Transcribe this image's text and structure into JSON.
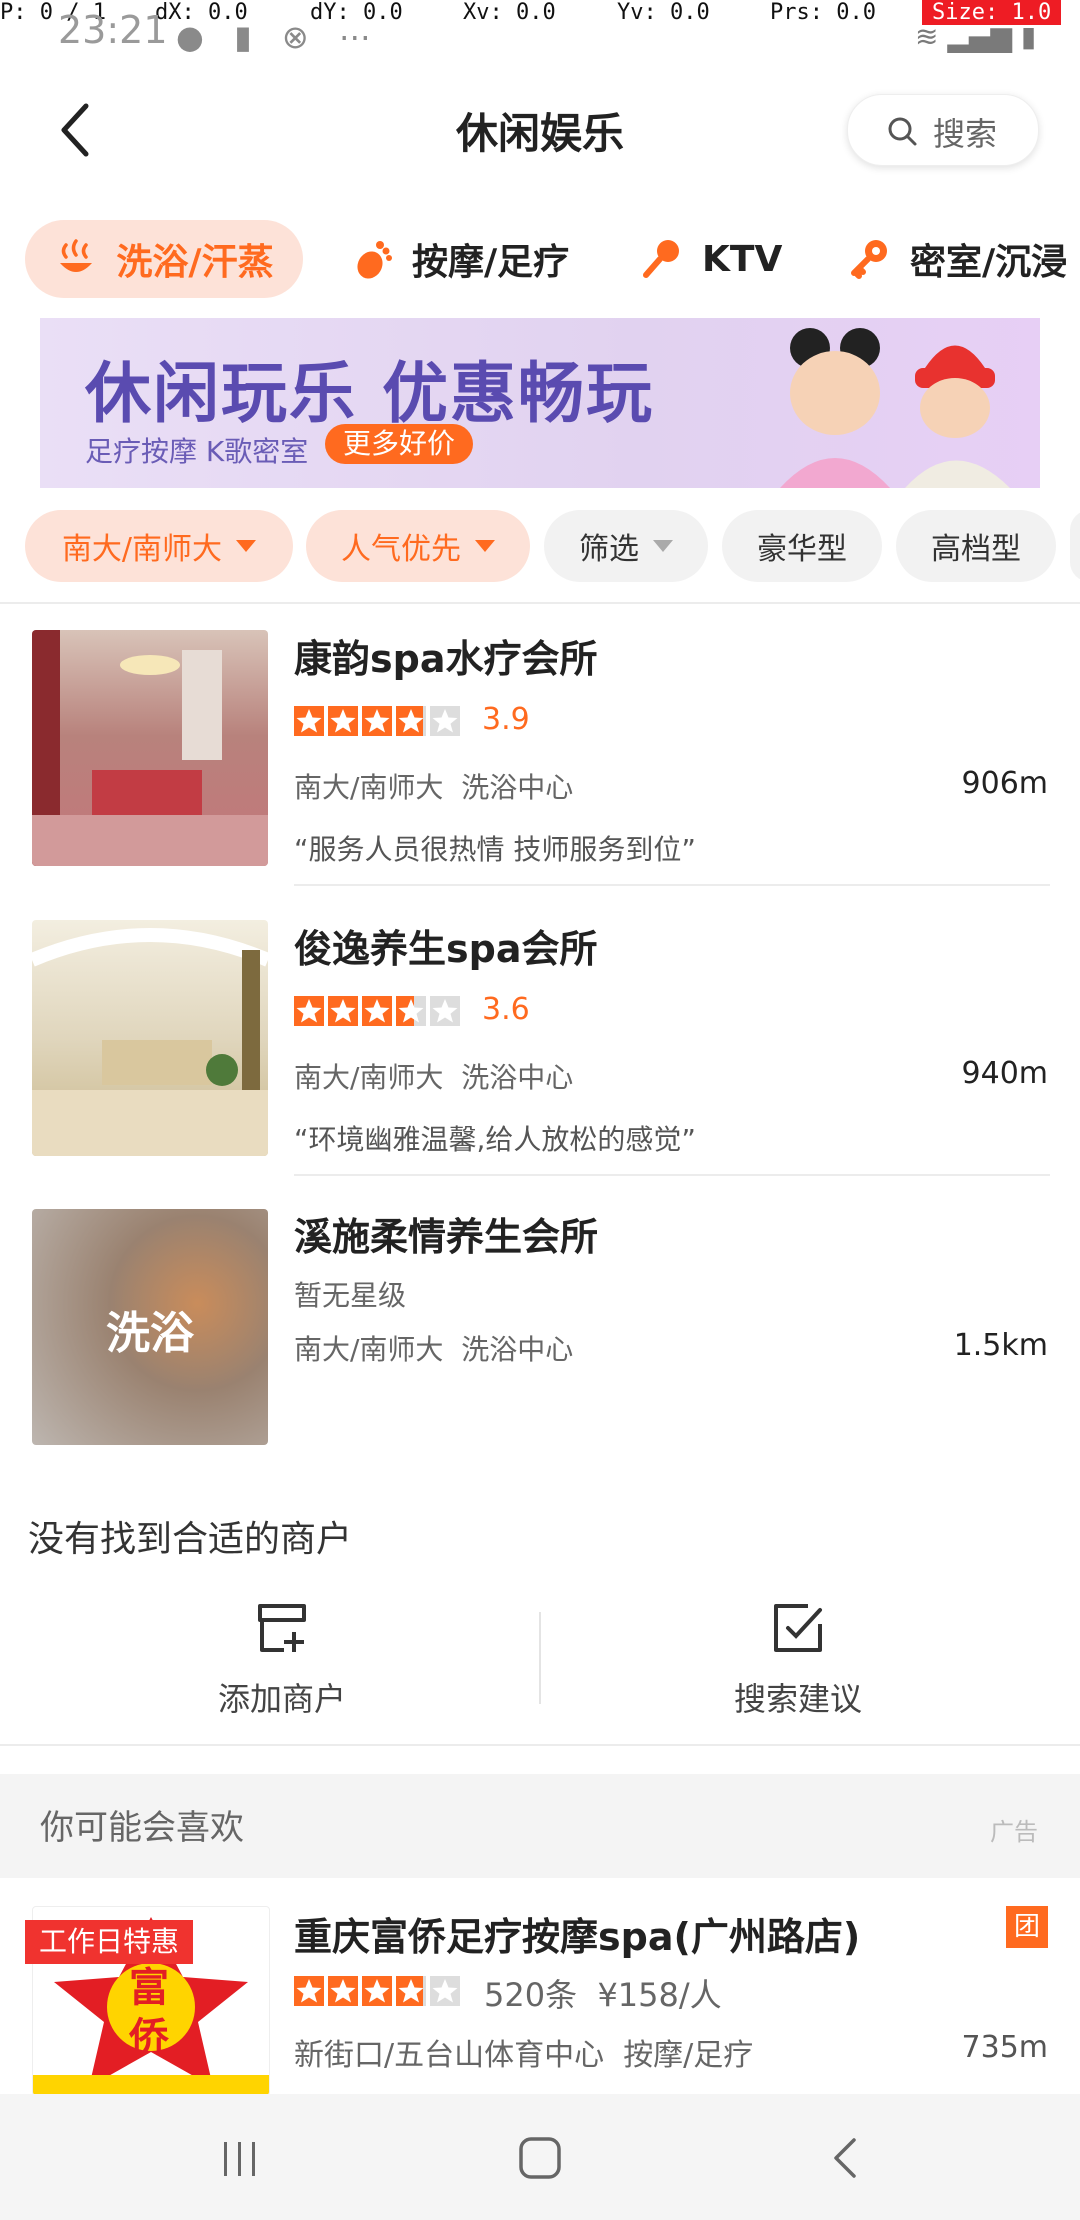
{
  "debug": {
    "p": "P: 0 / 1",
    "dx": "dX: 0.0",
    "dy": "dY: 0.0",
    "xv": "Xv: 0.0",
    "yv": "Yv: 0.0",
    "prs": "Prs: 0.0",
    "size": "Size: 1.0"
  },
  "status": {
    "time": "23:21"
  },
  "header": {
    "title": "休闲娱乐",
    "search_label": "搜索"
  },
  "categories": [
    {
      "label": "洗浴/汗蒸"
    },
    {
      "label": "按摩/足疗"
    },
    {
      "label": "KTV"
    },
    {
      "label": "密室/沉浸"
    }
  ],
  "banner": {
    "headline": "休闲玩乐 优惠畅玩",
    "subtitle": "足疗按摩 K歌密室",
    "cta": "更多好价"
  },
  "filters": [
    {
      "label": "南大/南师大"
    },
    {
      "label": "人气优先"
    },
    {
      "label": "筛选"
    },
    {
      "label": "豪华型"
    },
    {
      "label": "高档型"
    }
  ],
  "listings": [
    {
      "name": "康韵spa水疗会所",
      "rating": "3.9",
      "area": "南大/南师大",
      "category": "洗浴中心",
      "distance": "906m",
      "quote": "“服务人员很热情 技师服务到位”"
    },
    {
      "name": "俊逸养生spa会所",
      "rating": "3.6",
      "area": "南大/南师大",
      "category": "洗浴中心",
      "distance": "940m",
      "quote": "“环境幽雅温馨,给人放松的感觉”"
    },
    {
      "name": "溪施柔情养生会所",
      "no_rating": "暂无星级",
      "area": "南大/南师大",
      "category": "洗浴中心",
      "distance": "1.5km",
      "thumb_label": "洗浴"
    }
  ],
  "no_match": {
    "text": "没有找到合适的商户",
    "add_label": "添加商户",
    "suggest_label": "搜索建议"
  },
  "recommend": {
    "title": "你可能会喜欢",
    "ad_label": "广告",
    "item": {
      "promo": "工作日特惠",
      "name": "重庆富侨足疗按摩spa(广州路店)",
      "reviews": "520条",
      "price": "¥158/人",
      "area": "新街口/五台山体育中心",
      "category": "按摩/足疗",
      "distance": "735m",
      "badge": "团",
      "logo_text_top": "富",
      "logo_text_bottom": "侨"
    }
  },
  "colors": {
    "accent": "#ff6a1f",
    "active_bg": "#fde2d8"
  }
}
